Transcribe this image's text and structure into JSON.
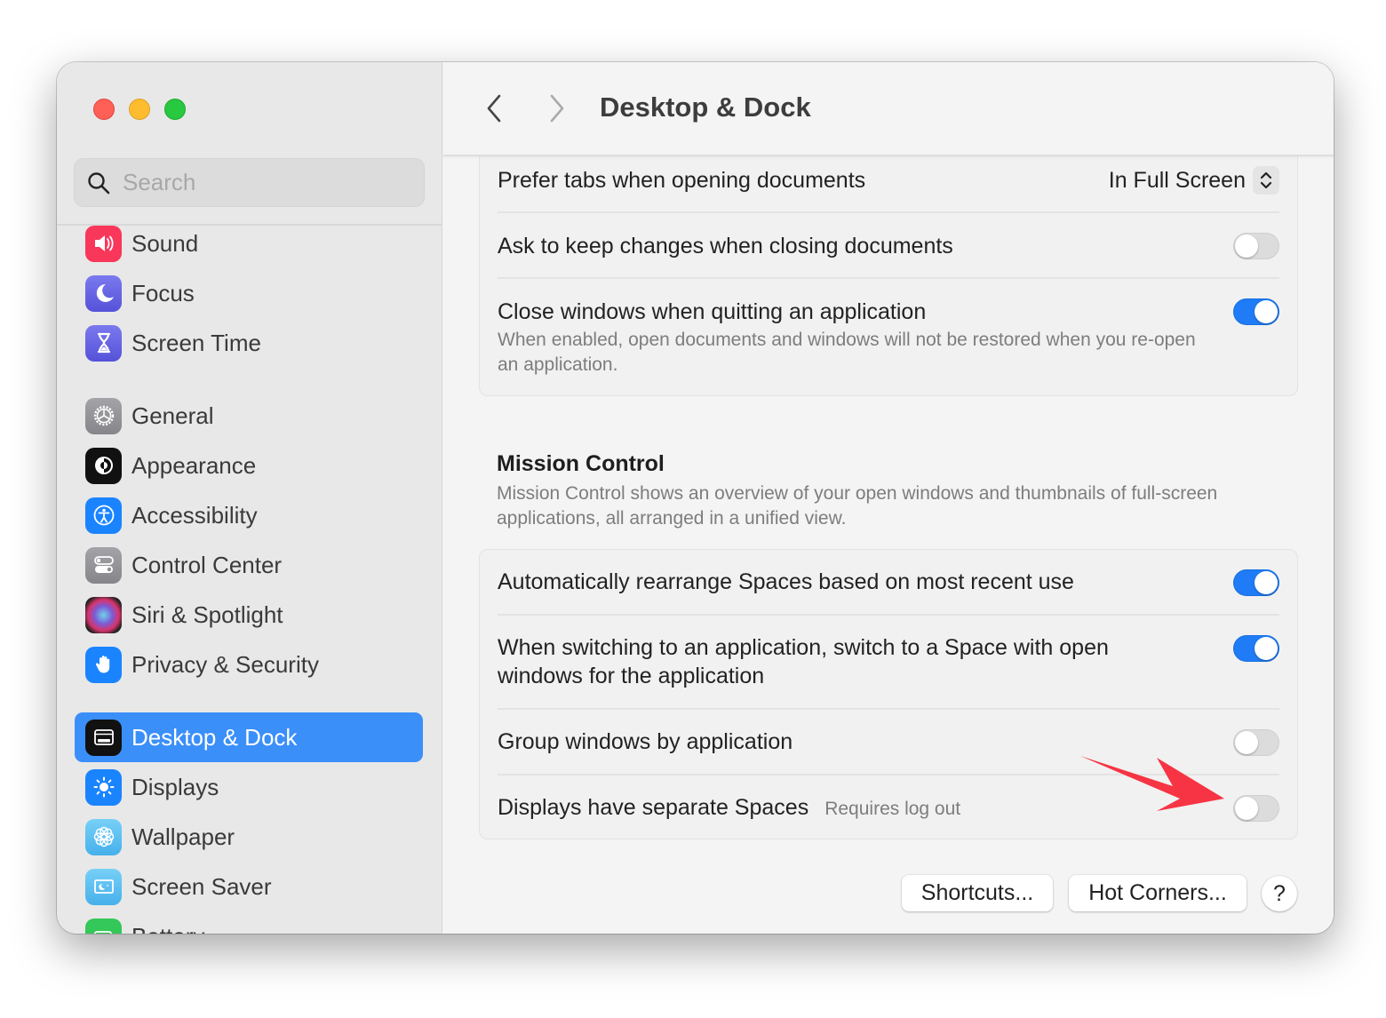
{
  "window": {
    "title": "Desktop & Dock"
  },
  "sidebar": {
    "search": {
      "placeholder": "Search",
      "value": ""
    },
    "items": [
      {
        "label": "Sound",
        "icon": "speaker-icon",
        "color": "#f8375a"
      },
      {
        "label": "Focus",
        "icon": "moon-icon",
        "color": "#5e5ce6"
      },
      {
        "label": "Screen Time",
        "icon": "hourglass-icon",
        "color": "#5e5ce6"
      },
      {
        "label": "General",
        "icon": "gear-icon",
        "color": "#8e8e93"
      },
      {
        "label": "Appearance",
        "icon": "appearance-icon",
        "color": "#111111"
      },
      {
        "label": "Accessibility",
        "icon": "accessibility-icon",
        "color": "#1a84ff"
      },
      {
        "label": "Control Center",
        "icon": "control-center-icon",
        "color": "#8e8e93"
      },
      {
        "label": "Siri & Spotlight",
        "icon": "siri-icon",
        "color": "#3a2a4a"
      },
      {
        "label": "Privacy & Security",
        "icon": "hand-icon",
        "color": "#1a84ff"
      },
      {
        "label": "Desktop & Dock",
        "icon": "desktop-dock-icon",
        "color": "#111111",
        "selected": true
      },
      {
        "label": "Displays",
        "icon": "sun-icon",
        "color": "#1a84ff"
      },
      {
        "label": "Wallpaper",
        "icon": "flower-icon",
        "color": "#55bef0"
      },
      {
        "label": "Screen Saver",
        "icon": "screen-saver-icon",
        "color": "#55bef0"
      },
      {
        "label": "Battery",
        "icon": "battery-icon",
        "color": "#34c759"
      }
    ]
  },
  "header": {
    "back_icon": "chevron-left-icon",
    "forward_icon": "chevron-right-icon",
    "title": "Desktop & Dock"
  },
  "windows_card": {
    "prefer_tabs": {
      "label": "Prefer tabs when opening documents",
      "value": "In Full Screen"
    },
    "ask_keep_changes": {
      "label": "Ask to keep changes when closing documents",
      "on": false
    },
    "close_windows": {
      "label": "Close windows when quitting an application",
      "description": "When enabled, open documents and windows will not be restored when you re-open an application.",
      "on": true
    }
  },
  "mission_control": {
    "title": "Mission Control",
    "description": "Mission Control shows an overview of your open windows and thumbnails of full-screen applications, all arranged in a unified view.",
    "settings": [
      {
        "label": "Automatically rearrange Spaces based on most recent use",
        "on": true
      },
      {
        "label": "When switching to an application, switch to a Space with open windows for the application",
        "on": true
      },
      {
        "label": "Group windows by application",
        "on": false
      },
      {
        "label": "Displays have separate Spaces",
        "hint": "Requires log out",
        "on": false
      }
    ]
  },
  "footer": {
    "shortcuts_label": "Shortcuts...",
    "hot_corners_label": "Hot Corners...",
    "help_label": "?"
  },
  "annotation": {
    "arrow_color": "#f73443",
    "points_to": "Displays have separate Spaces toggle"
  }
}
